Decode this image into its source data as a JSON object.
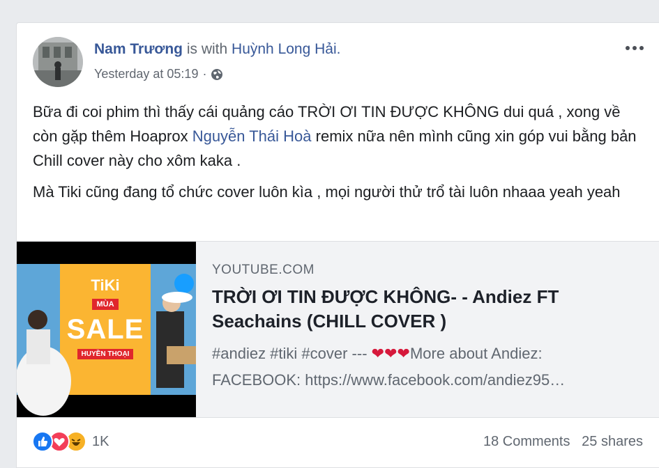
{
  "post": {
    "author": "Nam Trương",
    "with_text": "is with",
    "tagged": "Huỳnh Long Hải.",
    "timestamp": "Yesterday at 05:19",
    "separator": "·",
    "audience_icon": "globe-icon",
    "more_icon": "more-options-icon",
    "paragraph1_a": "Bữa đi coi phim thì thấy cái quảng cáo TRỜI ƠI TIN ĐƯỢC KHÔNG dui quá , xong về còn gặp thêm Hoaprox",
    "paragraph1_mention": "Nguyễn Thái Hoà",
    "paragraph1_b": "remix nữa nên mình cũng xin góp vui bằng bản Chill cover này cho xôm kaka .",
    "paragraph2": "Mà Tiki cũng đang tổ chức cover luôn kìa , mọi người thử trổ tài luôn nhaaa yeah yeah"
  },
  "preview": {
    "domain": "YOUTUBE.COM",
    "title": "TRỜI ƠI TIN ĐƯỢC KHÔNG- - Andiez FT Seachains (CHILL COVER )",
    "desc_a": "#andiez #tiki #cover ---",
    "desc_b": "More about Andiez:",
    "desc_line2": "FACEBOOK: https://www.facebook.com/andiez95…",
    "thumb_brand": "TiKi",
    "thumb_mua": "MÙA",
    "thumb_sale": "SALE",
    "thumb_sub": "HUYỀN THOẠI"
  },
  "footer": {
    "reaction_count": "1K",
    "comments": "18 Comments",
    "shares": "25 shares"
  },
  "colors": {
    "link": "#385898",
    "like": "#1877f2",
    "love": "#f33e58",
    "haha": "#f7b125",
    "tiki_bg": "#fbb532",
    "tiki_blue": "#189eff"
  }
}
